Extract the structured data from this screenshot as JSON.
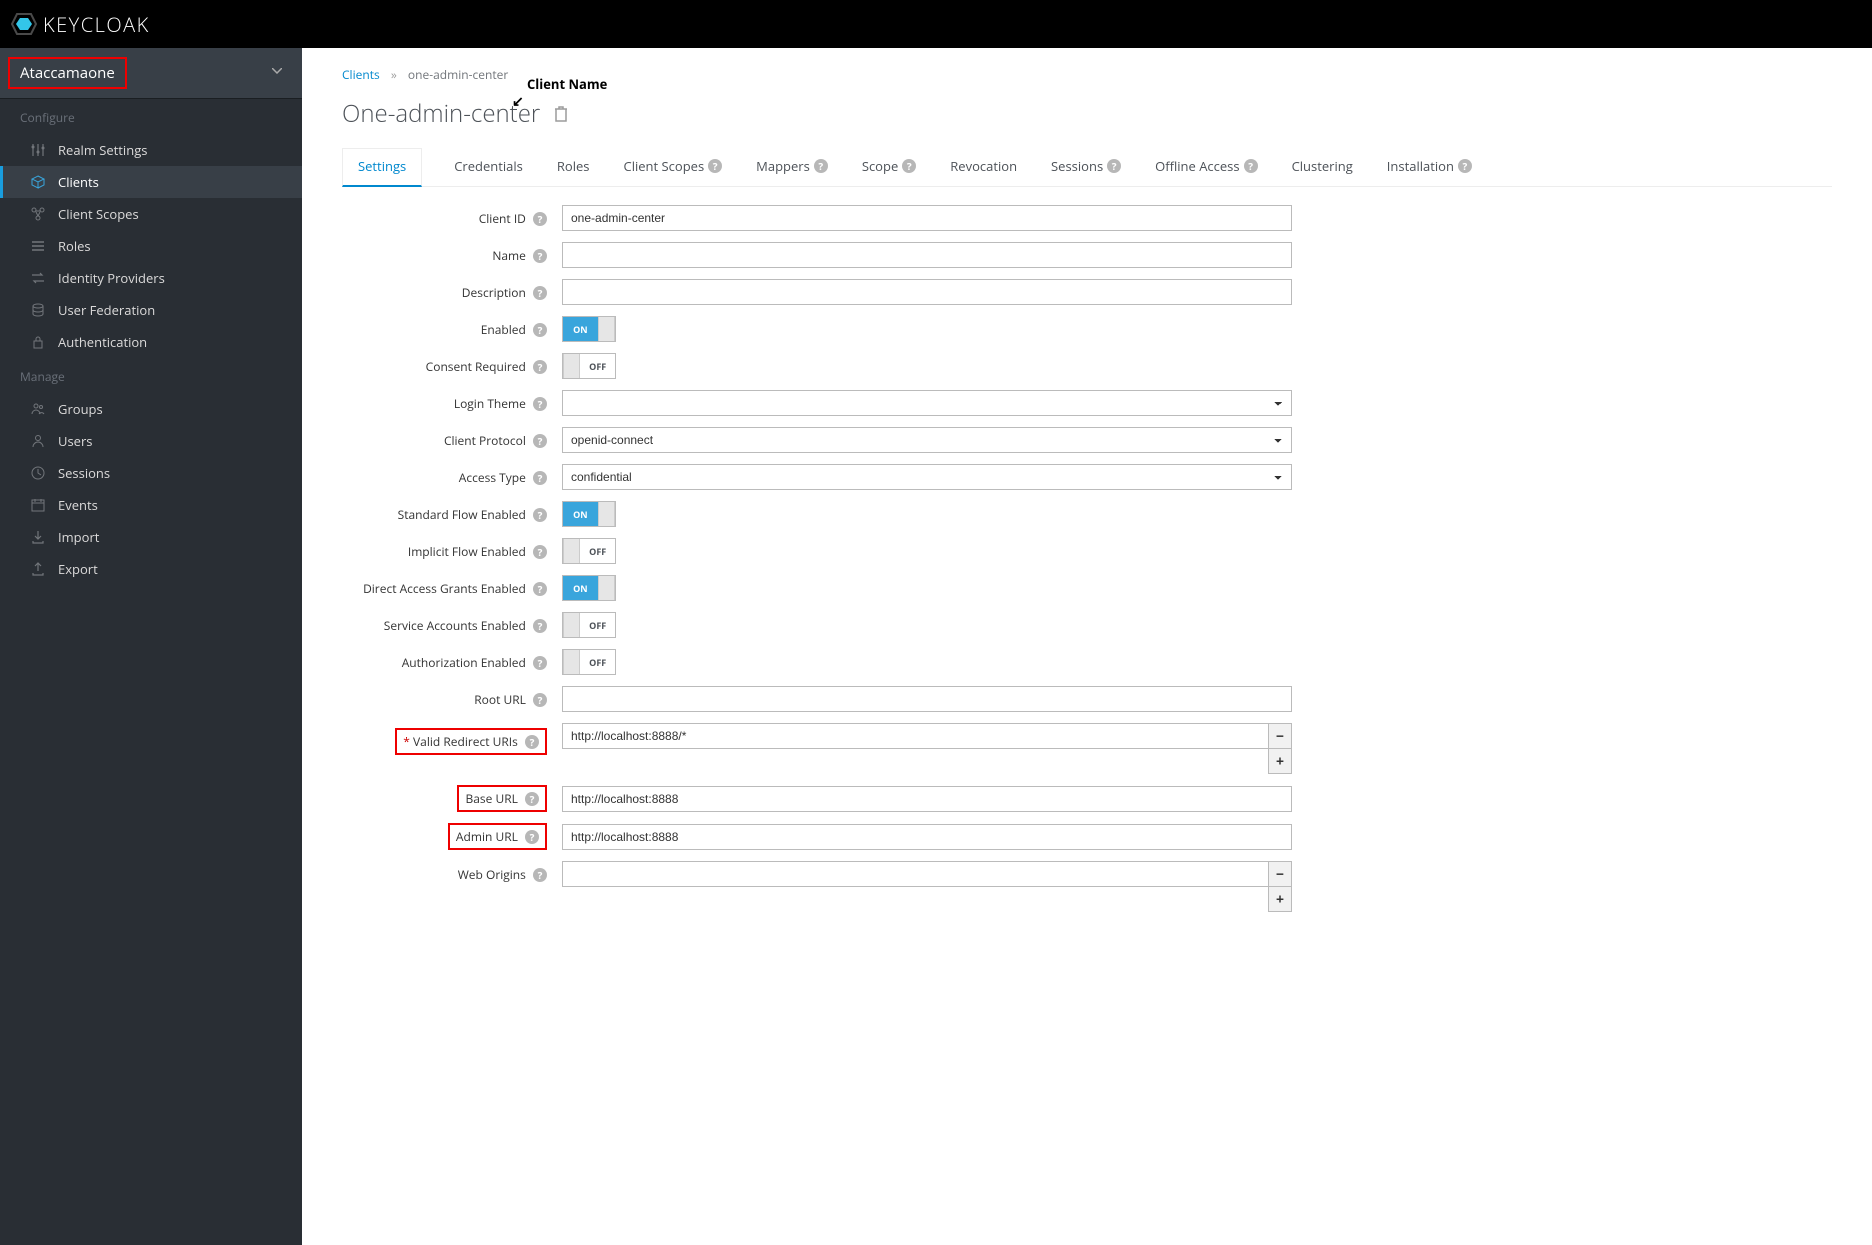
{
  "logoText": "KEYCLOAK",
  "realm": "Ataccamaone",
  "sidebar": {
    "configureHeader": "Configure",
    "manageHeader": "Manage",
    "configure": [
      {
        "label": "Realm Settings",
        "icon": "sliders"
      },
      {
        "label": "Clients",
        "icon": "cube",
        "active": true
      },
      {
        "label": "Client Scopes",
        "icon": "nodes"
      },
      {
        "label": "Roles",
        "icon": "list"
      },
      {
        "label": "Identity Providers",
        "icon": "exchange"
      },
      {
        "label": "User Federation",
        "icon": "database"
      },
      {
        "label": "Authentication",
        "icon": "lock"
      }
    ],
    "manage": [
      {
        "label": "Groups",
        "icon": "users"
      },
      {
        "label": "Users",
        "icon": "user"
      },
      {
        "label": "Sessions",
        "icon": "clock"
      },
      {
        "label": "Events",
        "icon": "calendar"
      },
      {
        "label": "Import",
        "icon": "import"
      },
      {
        "label": "Export",
        "icon": "export"
      }
    ]
  },
  "breadcrumb": {
    "root": "Clients",
    "current": "one-admin-center"
  },
  "pageTitle": "One-admin-center",
  "annotation": "Client Name",
  "tabs": [
    {
      "label": "Settings",
      "active": true
    },
    {
      "label": "Credentials"
    },
    {
      "label": "Roles"
    },
    {
      "label": "Client Scopes",
      "help": true
    },
    {
      "label": "Mappers",
      "help": true
    },
    {
      "label": "Scope",
      "help": true
    },
    {
      "label": "Revocation"
    },
    {
      "label": "Sessions",
      "help": true
    },
    {
      "label": "Offline Access",
      "help": true
    },
    {
      "label": "Clustering"
    },
    {
      "label": "Installation",
      "help": true
    }
  ],
  "form": {
    "clientId": {
      "label": "Client ID",
      "value": "one-admin-center"
    },
    "name": {
      "label": "Name",
      "value": ""
    },
    "description": {
      "label": "Description",
      "value": ""
    },
    "enabled": {
      "label": "Enabled",
      "state": "ON"
    },
    "consentRequired": {
      "label": "Consent Required",
      "state": "OFF"
    },
    "loginTheme": {
      "label": "Login Theme",
      "value": ""
    },
    "clientProtocol": {
      "label": "Client Protocol",
      "value": "openid-connect"
    },
    "accessType": {
      "label": "Access Type",
      "value": "confidential"
    },
    "standardFlowEnabled": {
      "label": "Standard Flow Enabled",
      "state": "ON"
    },
    "implicitFlowEnabled": {
      "label": "Implicit Flow Enabled",
      "state": "OFF"
    },
    "directAccessGrantsEnabled": {
      "label": "Direct Access Grants Enabled",
      "state": "ON"
    },
    "serviceAccountsEnabled": {
      "label": "Service Accounts Enabled",
      "state": "OFF"
    },
    "authorizationEnabled": {
      "label": "Authorization Enabled",
      "state": "OFF"
    },
    "rootUrl": {
      "label": "Root URL",
      "value": ""
    },
    "validRedirectUris": {
      "label": "Valid Redirect URIs",
      "required": true,
      "highlight": true,
      "entries": [
        "http://localhost:8888/*"
      ]
    },
    "baseUrl": {
      "label": "Base URL",
      "highlight": true,
      "value": "http://localhost:8888"
    },
    "adminUrl": {
      "label": "Admin URL",
      "highlight": true,
      "value": "http://localhost:8888"
    },
    "webOrigins": {
      "label": "Web Origins",
      "entries": [
        ""
      ]
    }
  },
  "toggle": {
    "onLabel": "ON",
    "offLabel": "OFF"
  }
}
